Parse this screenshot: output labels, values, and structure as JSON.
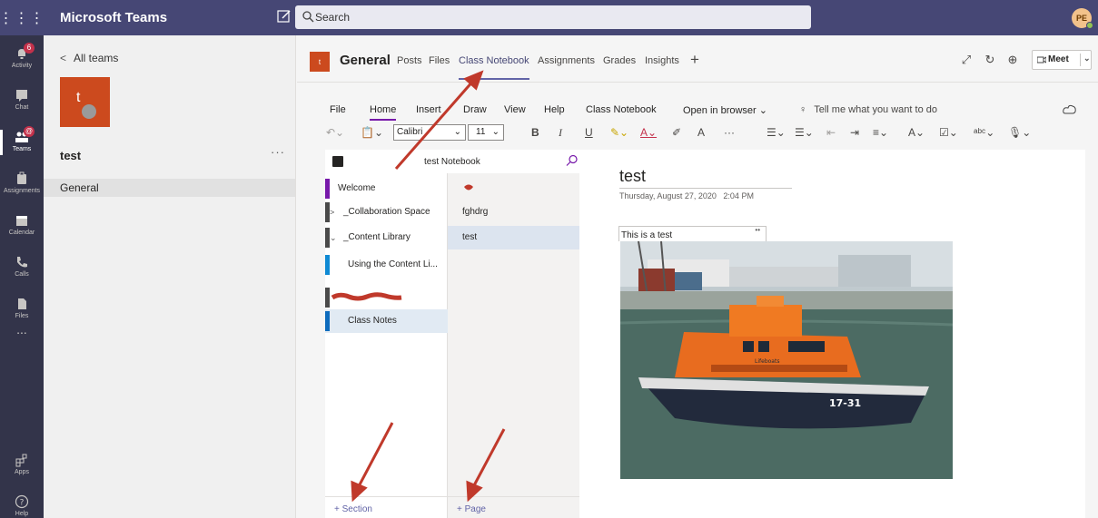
{
  "app": {
    "title": "Microsoft Teams",
    "search_placeholder": "Search",
    "avatar_initials": "PE"
  },
  "rail": [
    {
      "label": "Activity",
      "badge": "6"
    },
    {
      "label": "Chat",
      "badge": ""
    },
    {
      "label": "Teams",
      "badge": "@"
    },
    {
      "label": "Assignments",
      "badge": ""
    },
    {
      "label": "Calendar",
      "badge": ""
    },
    {
      "label": "Calls",
      "badge": ""
    },
    {
      "label": "Files",
      "badge": ""
    },
    {
      "label": "...",
      "badge": ""
    },
    {
      "label": "Apps",
      "badge": ""
    },
    {
      "label": "Help",
      "badge": ""
    }
  ],
  "team": {
    "back_label": "All teams",
    "avatar_letter": "t",
    "name": "test",
    "more": "···",
    "channels": [
      "General"
    ]
  },
  "channel": {
    "icon_letter": "t",
    "title": "General",
    "tabs": [
      "Posts",
      "Files",
      "Class Notebook",
      "Assignments",
      "Grades",
      "Insights"
    ],
    "add_tab": "+",
    "meet_label": "Meet"
  },
  "onenote": {
    "menu": [
      "File",
      "Home",
      "Insert",
      "Draw",
      "View",
      "Help",
      "Class Notebook",
      "Open in browser ⌄"
    ],
    "tell_me": "Tell me what you want to do",
    "font": "Calibri",
    "font_size": "11",
    "notebook_title": "test Notebook",
    "sections": [
      {
        "label": "Welcome",
        "color": "#7719aa"
      },
      {
        "label": "_Collaboration Space",
        "color": "#4a4a4a",
        "caret": ">"
      },
      {
        "label": "_Content Library",
        "color": "#4a4a4a",
        "caret": "⌄"
      },
      {
        "label": "Using the Content Li...",
        "color": "#0f8ad4",
        "sub": true
      },
      {
        "label": "Class Notes",
        "color": "#0f6cbd",
        "sub": true,
        "selected": true
      }
    ],
    "pages": [
      {
        "label": ""
      },
      {
        "label": "fghdrg"
      },
      {
        "label": "test",
        "selected": true
      }
    ],
    "add_section": "+ Section",
    "add_page": "+ Page",
    "page": {
      "title": "test",
      "date": "Thursday, August 27, 2020",
      "time": "2:04 PM",
      "note": "This is a test",
      "photo_text": "17-31",
      "photo_label": "Lifeboats"
    }
  },
  "colors": {
    "teams_purple": "#464775",
    "accent": "#6264a7",
    "onenote_purple": "#7719aa",
    "annotation_red": "#c0392b"
  }
}
